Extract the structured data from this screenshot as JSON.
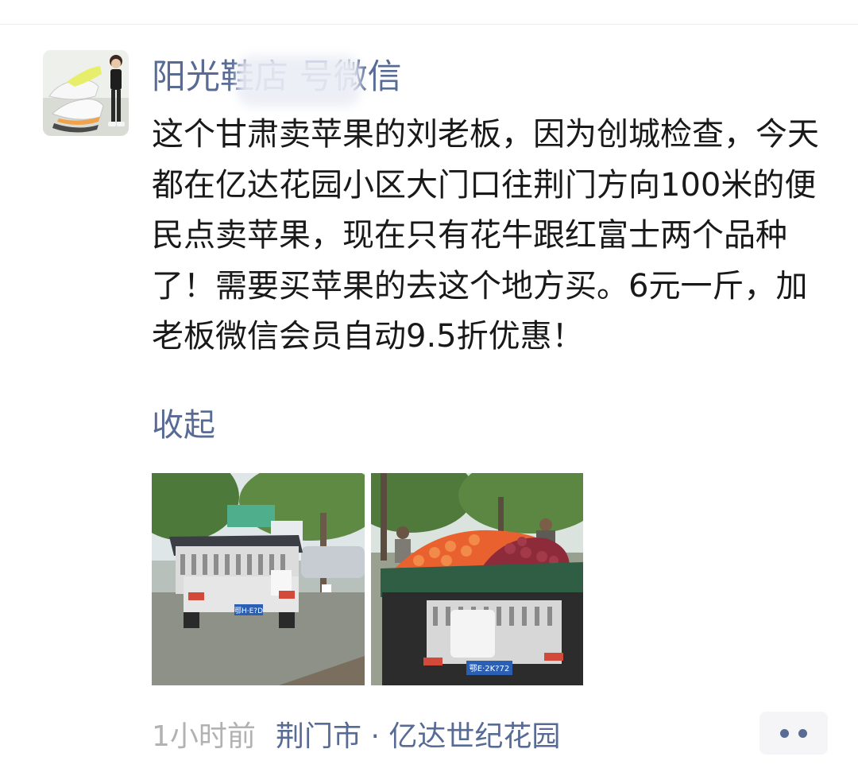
{
  "post": {
    "name": "阳光鞋店 号微信",
    "content": "这个甘肃卖苹果的刘老板，因为创城检查，今天都在亿达花园小区大门口往荆门方向100米的便民点卖苹果，现在只有花牛跟红富士两个品种了！需要买苹果的去这个地方买。6元一斤，加老板微信会员自动9.5折优惠！",
    "collapse_label": "收起",
    "time": "1小时前",
    "location": "荆门市 · 亿达世纪花园",
    "plate_1": "鄂H·E?D",
    "plate_2": "鄂E·2K?72"
  },
  "colors": {
    "link": "#576b95",
    "text": "#191919",
    "secondary": "#b2b2b2",
    "more_bg": "#f5f5f7"
  },
  "icons": [
    "more-dots-icon"
  ]
}
